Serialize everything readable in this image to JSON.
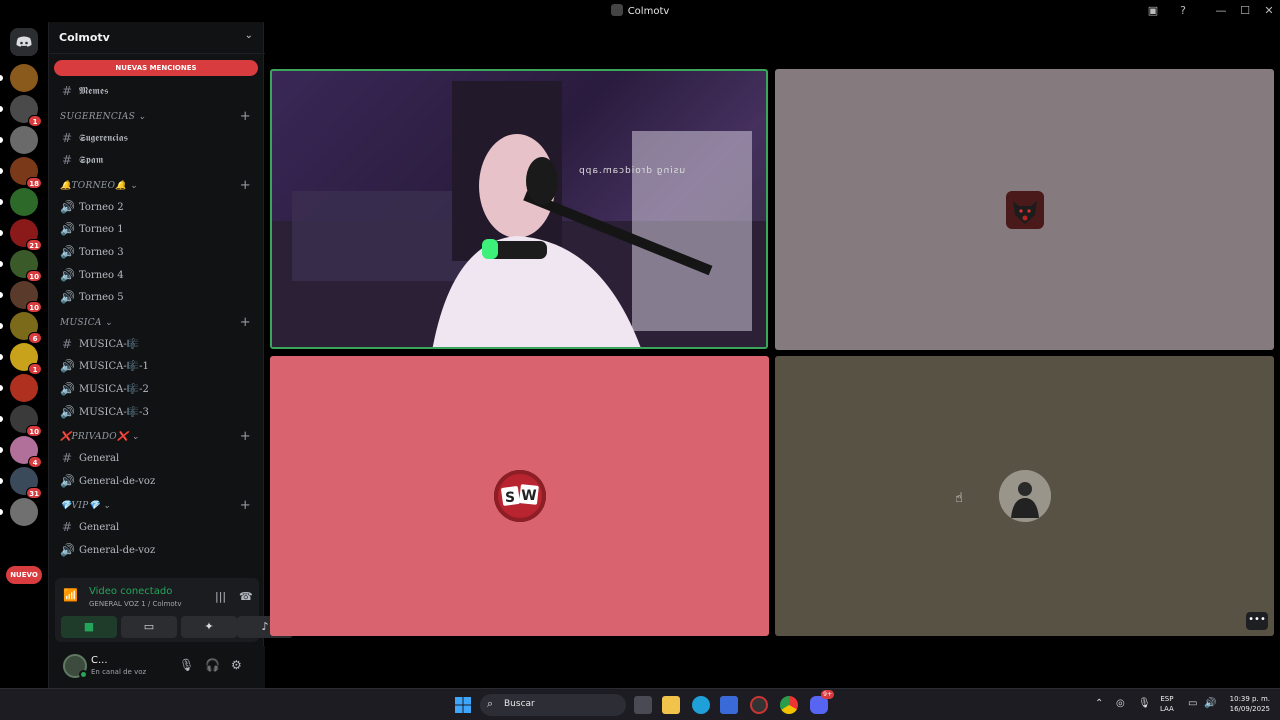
{
  "window": {
    "title": "Colmotv",
    "icons": [
      "inbox-icon",
      "help-icon",
      "minimize-icon",
      "maximize-icon",
      "close-icon"
    ]
  },
  "rail": {
    "servers": [
      {
        "name": "tierra-dorada",
        "badge": "",
        "color": "#8a5a1c"
      },
      {
        "name": "colmotv",
        "badge": "1",
        "color": "#4a4a4a"
      },
      {
        "name": "server-3",
        "badge": "",
        "color": "#6a6a6a"
      },
      {
        "name": "server-4",
        "badge": "18",
        "color": "#7a3a1a"
      },
      {
        "name": "server-5",
        "badge": "",
        "color": "#2d6a2a"
      },
      {
        "name": "server-6",
        "badge": "21",
        "color": "#8a1a1a"
      },
      {
        "name": "server-7",
        "badge": "10",
        "color": "#3a5a2a"
      },
      {
        "name": "server-8",
        "badge": "10",
        "color": "#5a3a2a"
      },
      {
        "name": "server-9",
        "badge": "6",
        "color": "#7a6a1a"
      },
      {
        "name": "server-10",
        "badge": "1",
        "color": "#c8a21a"
      },
      {
        "name": "server-11",
        "badge": "",
        "color": "#b03020"
      },
      {
        "name": "server-12",
        "badge": "10",
        "color": "#3a3a3a"
      },
      {
        "name": "server-13",
        "badge": "4",
        "color": "#b0709a"
      },
      {
        "name": "server-14",
        "badge": "31",
        "color": "#3a4a5a"
      },
      {
        "name": "server-15",
        "badge": "",
        "color": "#707070"
      }
    ],
    "new_label": "NUEVO"
  },
  "sidebar": {
    "guild_name": "Colmotv",
    "mentions_label": "NUEVAS MENCIONES",
    "items": [
      {
        "type": "channel",
        "sym": "#",
        "label": "𝕸𝖊𝖒𝖊𝖘"
      },
      {
        "type": "category",
        "label": "SUGERENCIAS ⌄"
      },
      {
        "type": "channel",
        "sym": "#",
        "label": "𝕾𝖚𝖌𝖊𝖗𝖊𝖓𝖈𝖎𝖆𝖘"
      },
      {
        "type": "channel",
        "sym": "#",
        "label": "𝕾𝖕𝖆𝖒"
      },
      {
        "type": "category",
        "label": "🔔TORNEO🔔 ⌄"
      },
      {
        "type": "channel",
        "sym": "🔊",
        "label": "Torneo 2"
      },
      {
        "type": "channel",
        "sym": "🔊",
        "label": "Torneo 1"
      },
      {
        "type": "channel",
        "sym": "🔊",
        "label": "Torneo 3"
      },
      {
        "type": "channel",
        "sym": "🔊",
        "label": "Torneo 4"
      },
      {
        "type": "channel",
        "sym": "🔊",
        "label": "Torneo 5"
      },
      {
        "type": "category",
        "label": "MUSICA ⌄"
      },
      {
        "type": "channel",
        "sym": "#",
        "label": "MUSICA-🎼"
      },
      {
        "type": "channel",
        "sym": "🔊",
        "label": "MUSICA-🎼-1"
      },
      {
        "type": "channel",
        "sym": "🔊",
        "label": "MUSICA-🎼-2"
      },
      {
        "type": "channel",
        "sym": "🔊",
        "label": "MUSICA-🎼-3"
      },
      {
        "type": "category",
        "label": "❌PRIVADO❌ ⌄"
      },
      {
        "type": "channel",
        "sym": "#",
        "label": "General"
      },
      {
        "type": "channel",
        "sym": "🔊",
        "label": "General-de-voz"
      },
      {
        "type": "category",
        "label": "💎VIP💎 ⌄"
      },
      {
        "type": "channel",
        "sym": "#",
        "label": "General"
      },
      {
        "type": "channel",
        "sym": "🔊",
        "label": "General-de-voz"
      }
    ]
  },
  "voice": {
    "status": "Video conectado",
    "channel": "GENERAL VOZ 1 / Colmotv"
  },
  "user": {
    "name": "C...",
    "status": "En canal de voz"
  },
  "video": {
    "overlay_text": "using droidcam.app",
    "tiles": [
      {
        "name": "camera-stream",
        "speaking": true
      },
      {
        "name": "participant-panther",
        "color": "#857a7d"
      },
      {
        "name": "participant-sw",
        "color": "#d9636e",
        "avatar_text": "SW"
      },
      {
        "name": "participant-photo",
        "color": "#575244"
      }
    ]
  },
  "taskbar": {
    "search_placeholder": "Buscar",
    "lang_line1": "ESP",
    "lang_line2": "LAA",
    "time": "10:39 p. m.",
    "date": "16/09/2025",
    "discord_badge": "9+"
  }
}
